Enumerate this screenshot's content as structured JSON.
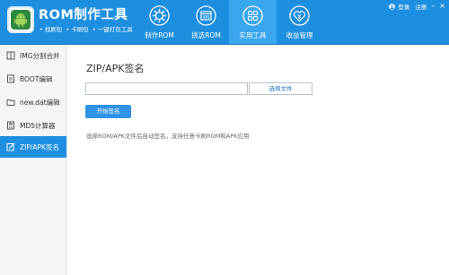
{
  "app": {
    "title": "ROM制作工具",
    "subtitle_items": [
      "• 找刷包",
      "• 卡刷包",
      "• 一键打包工具"
    ]
  },
  "tabs": [
    {
      "label": "制作ROM",
      "icon": "gear-icon",
      "active": false
    },
    {
      "label": "挑选ROM",
      "icon": "rom-package-icon",
      "active": false
    },
    {
      "label": "实用工具",
      "icon": "grid-apps-icon",
      "active": true
    },
    {
      "label": "收益管理",
      "icon": "heart-yen-icon",
      "active": false
    }
  ],
  "topbar": {
    "login": "登录",
    "register": "注册"
  },
  "sidebar": {
    "items": [
      {
        "label": "IMG分割合并",
        "icon": "img-split-icon",
        "active": false
      },
      {
        "label": "BOOT编辑",
        "icon": "boot-edit-icon",
        "active": false
      },
      {
        "label": "new.dat编辑",
        "icon": "folder-icon",
        "active": false
      },
      {
        "label": "MD5计算器",
        "icon": "calculator-icon",
        "active": false
      },
      {
        "label": "ZIP/APK签名",
        "icon": "sign-icon",
        "active": true
      }
    ]
  },
  "main": {
    "title": "ZIP/APK签名",
    "file_input_value": "",
    "choose_file_label": "选择文件",
    "start_sign_label": "开始签名",
    "hint": "选择ROM/APK文件后自动签名，支持任意卡刷ROM和APK应用"
  },
  "colors": {
    "header_bg": "#1e8fe0",
    "active_tab_bg": "#3aa6ee",
    "sidebar_active_bg": "#1e8fe0",
    "button_bg": "#2f93e6"
  }
}
